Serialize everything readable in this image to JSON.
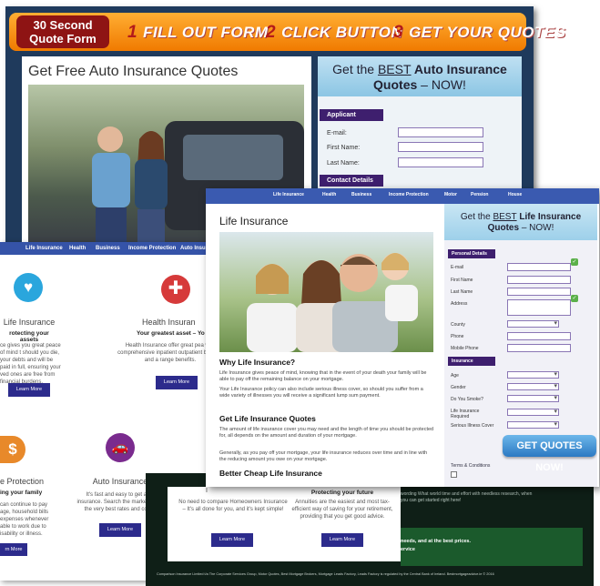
{
  "auto": {
    "banner": {
      "logo_line1": "30 Second",
      "logo_line2": "Quote Form",
      "steps": [
        {
          "num": "1",
          "label": "FILL OUT FORM"
        },
        {
          "num": "2",
          "label": "CLICK BUTTON"
        },
        {
          "num": "3",
          "label": "GET YOUR QUOTES"
        }
      ]
    },
    "title": "Get Free Auto Insurance Quotes",
    "form": {
      "head_pre": "Get the ",
      "head_best": "BEST",
      "head_bold": " Auto Insurance Quotes",
      "head_post": " – NOW!",
      "section_applicant": "Applicant",
      "email_label": "E-mail:",
      "first_label": "First Name:",
      "last_label": "Last Name:",
      "section_contact": "Contact Details"
    }
  },
  "life": {
    "nav": [
      "Life Insurance",
      "Health",
      "Business",
      "Income Protection",
      "Motor",
      "Pension",
      "House"
    ],
    "title": "Life Insurance",
    "h_why": "Why Life Insurance?",
    "p1": "Life Insurance gives peace of mind, knowing that in the event of your death your family will be able to pay off the remaining balance on your mortgage.",
    "p2": "Your Life Insurance policy can also include serious illness cover, so should you suffer from a wide variety of illnesses you will receive a significant lump sum payment.",
    "h_quotes": "Get Life Insurance Quotes",
    "p3": "The amount of life insurance cover you may need and the length of time you should be protected for, all depends on the amount and duration of your mortgage.",
    "p4": "Generally, as you pay off your mortgage, your life insurance reduces over time and in line with the reducing amount you owe on your mortgage.",
    "h_cheap": "Better Cheap Life Insurance",
    "form": {
      "head_pre": "Get the ",
      "head_best": "BEST",
      "head_bold": " Life Insurance Quotes",
      "head_post": " – NOW!",
      "section_personal": "Personal Details",
      "fields": [
        "E-mail",
        "First Name",
        "Last Name",
        "Address",
        "County",
        "Phone",
        "Mobile Phone"
      ],
      "section_insurance": "Insurance",
      "ins_fields": [
        "Age",
        "Gender",
        "Do You Smoke?",
        "Life Insurance Required",
        "Serious Illness Cover"
      ],
      "cta": "GET QUOTES NOW!",
      "terms": "Terms & Conditions"
    }
  },
  "overview": {
    "nav": [
      "Life Insurance",
      "Health",
      "Business",
      "Income Protection",
      "Auto Insu"
    ],
    "cards": [
      {
        "title": "Life Insurance",
        "sub": "rotecting your assets",
        "text": "ce gives you great peace of mind t should you die, your debts and will be paid in full, ensuring your ved ones are free from financial burdens.",
        "button": "Learn More"
      },
      {
        "title": "Health Insuran",
        "sub": "Your greatest asset – Yo",
        "text": "Health Insurance offer great pea with comprehensive inpatient outpatient benefits and a range benefits.",
        "button": "Learn More"
      },
      {
        "title": "e Protection",
        "sub": "ing your family",
        "text": "can continue to pay age, household bills expenses whenever able to work due to isability or illness.",
        "button": "rn More"
      },
      {
        "title": "Auto Insurance",
        "sub": "",
        "text": "It's fast and easy to get auto insurance. Search the market to get the very best rates and cover.",
        "button": "Learn More"
      }
    ],
    "bottom_cards": [
      {
        "title": "I",
        "text": "No need to compare Homeowners Insurance – It's all done for you, and it's kept simple!",
        "button": "Learn More"
      },
      {
        "title": "Protecting your future",
        "text": "Annuities are the easiest and most tax-efficient way of saving for your retirement, providing that you get good advice.",
        "button": "Learn More"
      }
    ],
    "icons": [
      "heart-pulse-icon",
      "medical-cross-icon",
      "dollar-icon",
      "car-icon"
    ]
  },
  "dark": {
    "line1": "wording  What world time and effort with needless research, when",
    "line2": "you can get started right here!",
    "line3": "needs, and at the best prices.",
    "line4": "ervice",
    "footer": "Comparison Insurance Limited t/a The Corporate Services Group, Motor Quotes, Best Mortgage Brokers, Mortgage Leads Factory, Leads Factory is regulated by the Central Bank of Ireland. Bestmortgageadvice.ie © 2016"
  },
  "colors": {
    "banner_orange": "#f38a12",
    "form_purple": "#3e1f6e",
    "nav_blue": "#3a5ab0",
    "icon_blue": "#2aa6dd",
    "icon_red": "#d63a3a",
    "icon_orange": "#e8892a",
    "icon_purple": "#7a2b8e"
  }
}
